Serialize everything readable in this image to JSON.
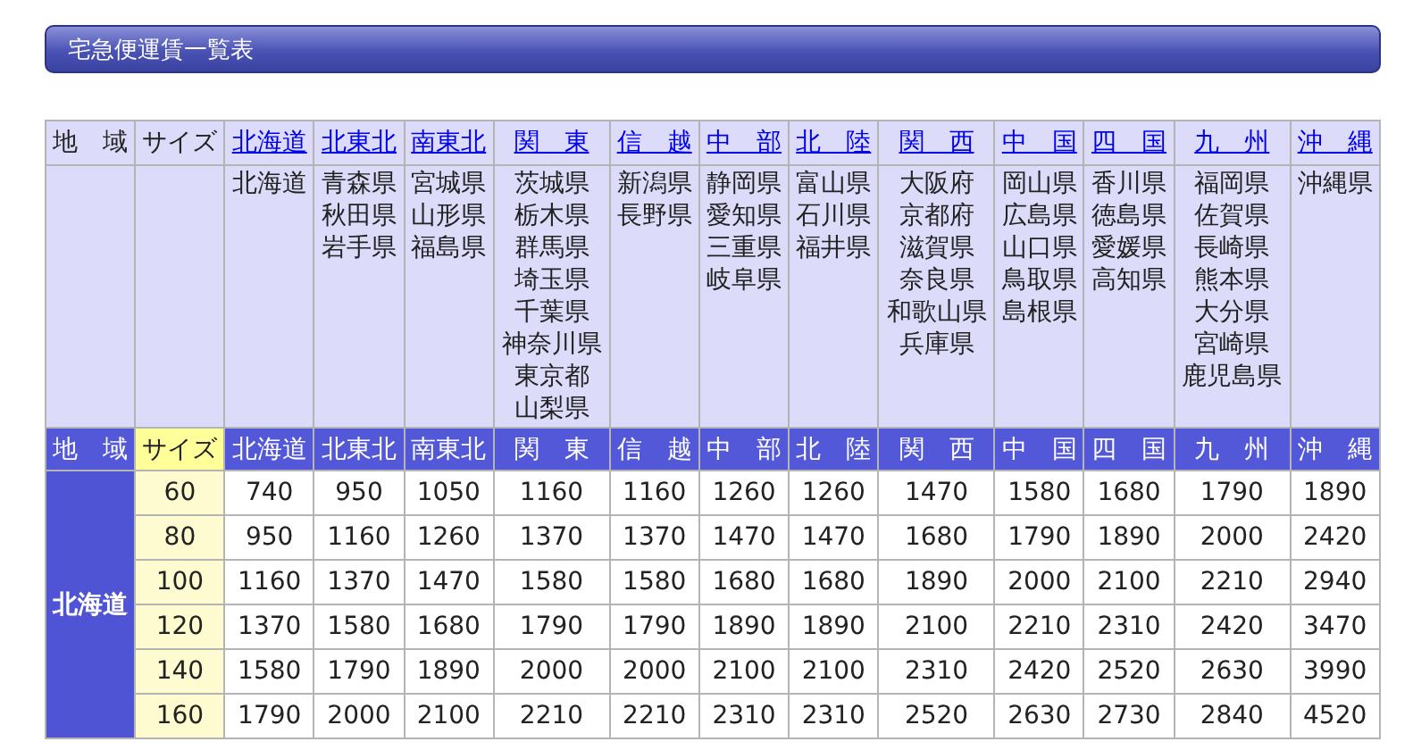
{
  "title": "宅急便運賃一覧表",
  "table": {
    "header": {
      "region_label": "地　域",
      "size_label": "サイズ",
      "regions": [
        {
          "name": "北海道",
          "prefectures": [
            "北海道"
          ]
        },
        {
          "name": "北東北",
          "prefectures": [
            "青森県",
            "秋田県",
            "岩手県"
          ]
        },
        {
          "name": "南東北",
          "prefectures": [
            "宮城県",
            "山形県",
            "福島県"
          ]
        },
        {
          "name": "関　東",
          "prefectures": [
            "茨城県",
            "栃木県",
            "群馬県",
            "埼玉県",
            "千葉県",
            "神奈川県",
            "東京都",
            "山梨県"
          ]
        },
        {
          "name": "信　越",
          "prefectures": [
            "新潟県",
            "長野県"
          ]
        },
        {
          "name": "中　部",
          "prefectures": [
            "静岡県",
            "愛知県",
            "三重県",
            "岐阜県"
          ]
        },
        {
          "name": "北　陸",
          "prefectures": [
            "富山県",
            "石川県",
            "福井県"
          ]
        },
        {
          "name": "関　西",
          "prefectures": [
            "大阪府",
            "京都府",
            "滋賀県",
            "奈良県",
            "和歌山県",
            "兵庫県"
          ]
        },
        {
          "name": "中　国",
          "prefectures": [
            "岡山県",
            "広島県",
            "山口県",
            "鳥取県",
            "島根県"
          ]
        },
        {
          "name": "四　国",
          "prefectures": [
            "香川県",
            "徳島県",
            "愛媛県",
            "高知県"
          ]
        },
        {
          "name": "九　州",
          "prefectures": [
            "福岡県",
            "佐賀県",
            "長崎県",
            "熊本県",
            "大分県",
            "宮崎県",
            "鹿児島県"
          ]
        },
        {
          "name": "沖　縄",
          "prefectures": [
            "沖縄県"
          ]
        }
      ]
    },
    "price_header": {
      "region_label": "地　域",
      "size_label": "サイズ",
      "regions": [
        "北海道",
        "北東北",
        "南東北",
        "関　東",
        "信　越",
        "中　部",
        "北　陸",
        "関　西",
        "中　国",
        "四　国",
        "九　州",
        "沖　縄"
      ]
    },
    "groups": [
      {
        "origin": "北海道",
        "rows": [
          {
            "size": "60",
            "prices": [
              "740",
              "950",
              "1050",
              "1160",
              "1160",
              "1260",
              "1260",
              "1470",
              "1580",
              "1680",
              "1790",
              "1890"
            ]
          },
          {
            "size": "80",
            "prices": [
              "950",
              "1160",
              "1260",
              "1370",
              "1370",
              "1470",
              "1470",
              "1680",
              "1790",
              "1890",
              "2000",
              "2420"
            ]
          },
          {
            "size": "100",
            "prices": [
              "1160",
              "1370",
              "1470",
              "1580",
              "1580",
              "1680",
              "1680",
              "1890",
              "2000",
              "2100",
              "2210",
              "2940"
            ]
          },
          {
            "size": "120",
            "prices": [
              "1370",
              "1580",
              "1680",
              "1790",
              "1790",
              "1890",
              "1890",
              "2100",
              "2210",
              "2310",
              "2420",
              "3470"
            ]
          },
          {
            "size": "140",
            "prices": [
              "1580",
              "1790",
              "1890",
              "2000",
              "2000",
              "2100",
              "2100",
              "2310",
              "2420",
              "2520",
              "2630",
              "3990"
            ]
          },
          {
            "size": "160",
            "prices": [
              "1790",
              "2000",
              "2100",
              "2210",
              "2210",
              "2310",
              "2310",
              "2520",
              "2630",
              "2730",
              "2840",
              "4520"
            ]
          }
        ]
      }
    ]
  }
}
